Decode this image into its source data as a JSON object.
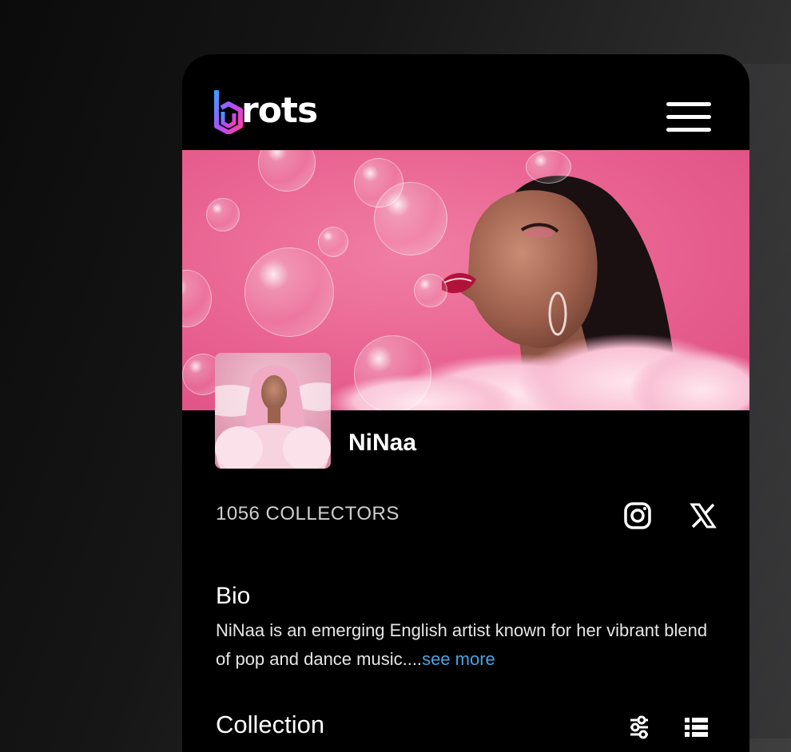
{
  "header": {
    "logo_text": "rots",
    "menu_icon": "hamburger-menu-icon"
  },
  "profile": {
    "name": "NiNaa",
    "collectors": "1056 COLLECTORS",
    "social_icons": [
      "instagram-icon",
      "x-twitter-icon"
    ]
  },
  "bio": {
    "heading": "Bio",
    "text": "NiNaa is an emerging English artist known for her vibrant blend of pop and dance music....",
    "see_more": "see more"
  },
  "collection": {
    "heading": "Collection",
    "icons": [
      "filter-sliders-icon",
      "list-view-icon"
    ]
  },
  "colors": {
    "background": "#000000",
    "banner_pink": "#e8608f",
    "link_blue": "#4aa3df",
    "logo_gradient": [
      "#3aa0ff",
      "#b14dff",
      "#ff3fa0"
    ]
  }
}
